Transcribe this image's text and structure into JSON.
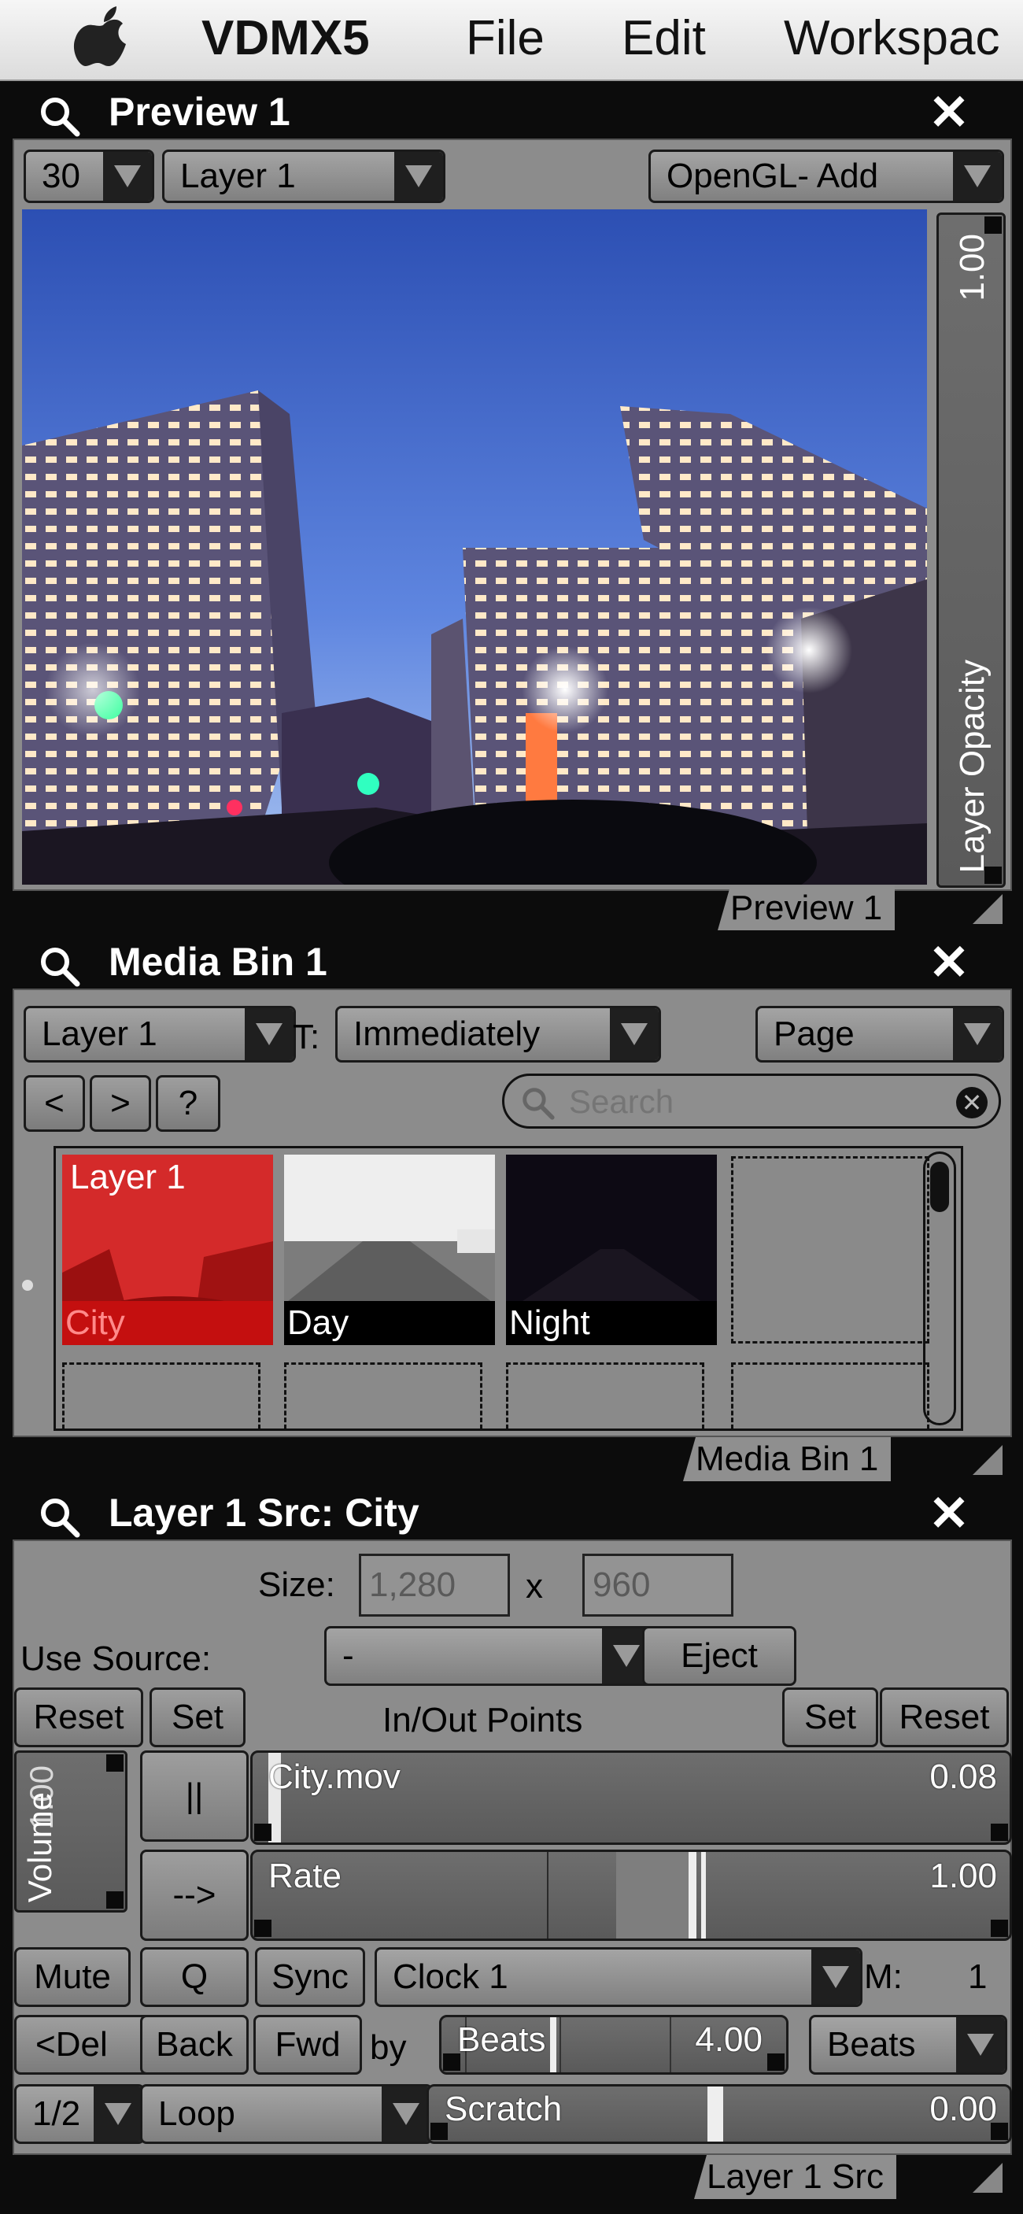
{
  "menubar": {
    "app_name": "VDMX5",
    "items": [
      "File",
      "Edit",
      "Workspac"
    ]
  },
  "preview": {
    "title": "Preview 1",
    "fps": "30",
    "layer": "Layer 1",
    "blend_mode": "OpenGL- Add",
    "opacity_value": "1.00",
    "opacity_label": "Layer Opacity",
    "opacity_level": 1.0,
    "tab": "Preview 1"
  },
  "media_bin": {
    "title": "Media Bin 1",
    "layer": "Layer 1",
    "trigger_label": "T:",
    "trigger_mode": "Immediately",
    "page_popup": "Page",
    "nav_prev": "<",
    "nav_next": ">",
    "help": "?",
    "search_placeholder": "Search",
    "tiles": [
      {
        "name": "City",
        "layer_badge": "Layer 1",
        "active": true
      },
      {
        "name": "Day",
        "active": false
      },
      {
        "name": "Night",
        "active": false
      }
    ],
    "tab": "Media Bin 1"
  },
  "layer_src": {
    "title": "Layer 1 Src: City",
    "size_label": "Size:",
    "width": "1,280",
    "x_label": "x",
    "height": "960",
    "use_source_label": "Use Source:",
    "use_source_value": "-",
    "eject": "Eject",
    "reset_left": "Reset",
    "set_left": "Set",
    "inout_label": "In/Out Points",
    "set_right": "Set",
    "reset_right": "Reset",
    "volume_label": "Volume",
    "volume_value": "1.00",
    "pause": "||",
    "play": "-->",
    "clip_name": "City.mov",
    "clip_position": "0.08",
    "rate_label": "Rate",
    "rate_value": "1.00",
    "mute": "Mute",
    "q": "Q",
    "sync": "Sync",
    "clock": "Clock 1",
    "m_label": "M:",
    "m_value": "1",
    "del": "<Del",
    "back": "Back",
    "fwd": "Fwd",
    "by": "by",
    "beats_label": "Beats",
    "beats_value": "4.00",
    "beats_popup": "Beats",
    "half": "1/2",
    "loop": "Loop",
    "scratch_label": "Scratch",
    "scratch_value": "0.00",
    "tab": "Layer 1 Src"
  }
}
